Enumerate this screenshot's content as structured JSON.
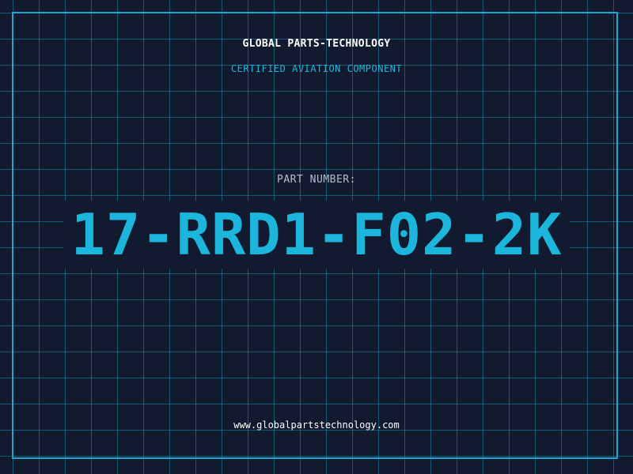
{
  "header": {
    "company": "GLOBAL PARTS-TECHNOLOGY",
    "tagline": "CERTIFIED AVIATION COMPONENT"
  },
  "part": {
    "label": "PART NUMBER:",
    "number": "17-RRD1-F02-2K"
  },
  "footer": {
    "website": "www.globalpartstechnology.com"
  },
  "colors": {
    "background": "#111a2e",
    "grid": "#178caa",
    "accent": "#1cb6dd",
    "text_primary": "#ffffff",
    "text_muted": "#b6bfcc"
  }
}
